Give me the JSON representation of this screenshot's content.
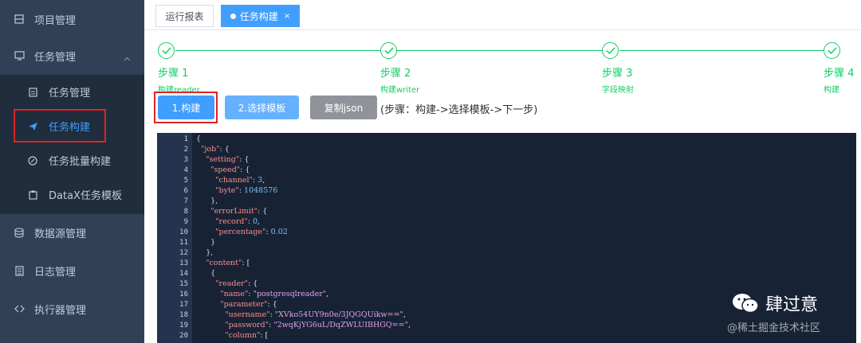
{
  "sidebar": {
    "items": [
      {
        "label": "项目管理",
        "icon": "project-icon"
      },
      {
        "label": "任务管理",
        "icon": "monitor-icon",
        "expanded": true
      },
      {
        "label": "数据源管理",
        "icon": "database-icon"
      },
      {
        "label": "日志管理",
        "icon": "document-icon"
      },
      {
        "label": "执行器管理",
        "icon": "executor-icon"
      }
    ],
    "submenu": [
      {
        "label": "任务管理",
        "icon": "task-list-icon"
      },
      {
        "label": "任务构建",
        "icon": "send-icon",
        "active": true
      },
      {
        "label": "任务批量构建",
        "icon": "batch-icon"
      },
      {
        "label": "DataX任务模板",
        "icon": "template-icon"
      }
    ]
  },
  "tabs": [
    {
      "label": "运行报表",
      "active": false
    },
    {
      "label": "任务构建",
      "active": true,
      "close": "×"
    }
  ],
  "steps": [
    {
      "title": "步骤 1",
      "desc": "构建reader"
    },
    {
      "title": "步骤 2",
      "desc": "构建writer"
    },
    {
      "title": "步骤 3",
      "desc": "字段映射"
    },
    {
      "title": "步骤 4",
      "desc": "构建"
    }
  ],
  "buttons": {
    "build": "1.构建",
    "template": "2.选择模板",
    "copy": "复制json",
    "hint": "(步骤：构建->选择模板->下一步)"
  },
  "editor": {
    "line_numbers": [
      "1",
      "2",
      "3",
      "4",
      "5",
      "6",
      "7",
      "8",
      "9",
      "10",
      "11",
      "12",
      "13",
      "14",
      "15",
      "16",
      "17",
      "18",
      "19",
      "20"
    ]
  },
  "watermark": {
    "name": "肆过意",
    "site": "@稀土掘金技术社区"
  },
  "colors": {
    "sidebar_bg": "#304156",
    "submenu_bg": "#1f2d3d",
    "primary": "#409eff",
    "success": "#13ce66",
    "editor_bg": "#172335"
  }
}
